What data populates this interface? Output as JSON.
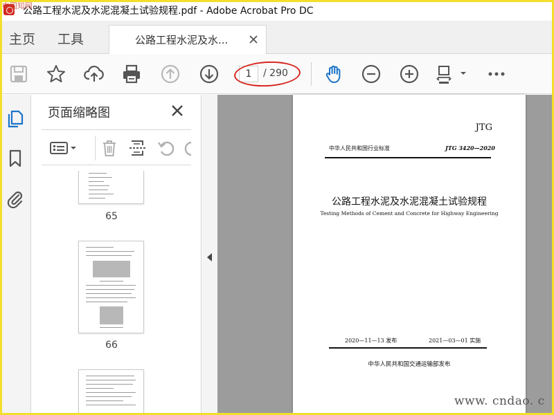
{
  "window": {
    "title": "公路工程水泥及水泥混凝土试验规程.pdf - Adobe Acrobat Pro DC",
    "corner_watermark": "中国知网"
  },
  "tabs": {
    "home": "主页",
    "tools": "工具",
    "document": "公路工程水泥及水..."
  },
  "toolbar": {
    "current_page": "1",
    "total_pages": "/ 290",
    "icons": [
      "save-icon",
      "bookmark-star-icon",
      "upload-icon",
      "print-icon",
      "prev-page-icon",
      "next-page-icon",
      "hand-tool-icon",
      "zoom-out-icon",
      "zoom-in-icon",
      "fit-page-icon",
      "more-icon"
    ],
    "accent_color": "#1a73c8",
    "highlight_color": "#d7261e"
  },
  "sidebar": {
    "rail_icons": [
      "page-thumbnails-icon",
      "bookmark-icon",
      "attachment-icon"
    ],
    "panel_title": "页面缩略图",
    "thumbnails": [
      {
        "page_label": "65"
      },
      {
        "page_label": "66"
      }
    ]
  },
  "document": {
    "jtg": "JTG",
    "standard_label": "中华人民共和国行业标准",
    "standard_code": "JTG 3420—2020",
    "title": "公路工程水泥及水泥混凝土试验规程",
    "subtitle": "Testing Methods of Cement and Concrete for Highway Engineering",
    "issue_date": "2020—11—13 发布",
    "implement_date": "2021—03—01 实施",
    "publisher": "中华人民共和国交通运输部发布"
  },
  "watermark": "www. cndao. c"
}
